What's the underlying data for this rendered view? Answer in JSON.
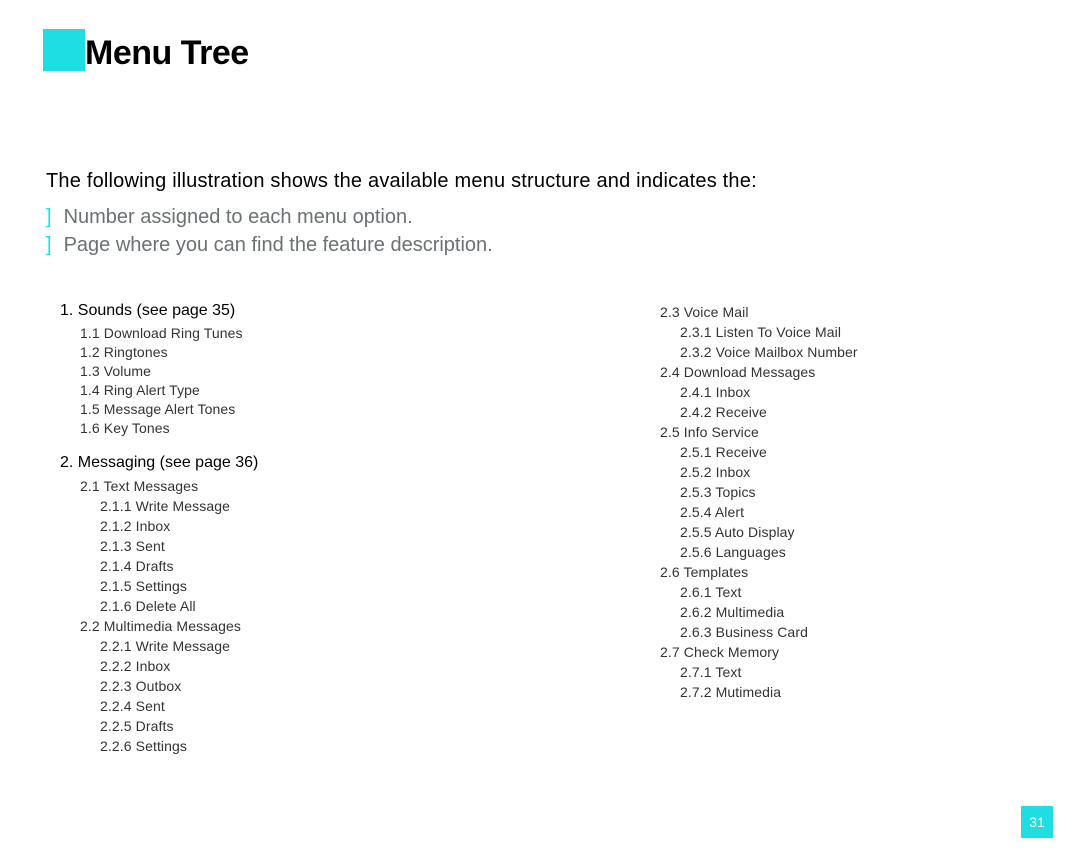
{
  "title": "Menu Tree",
  "intro": "The following illustration shows the available menu structure and indicates the:",
  "bullets": [
    "Number assigned to each menu option.",
    "Page where you can find the feature description."
  ],
  "leftColumn": {
    "sections": [
      {
        "heading": "1.  Sounds (see page 35)",
        "items": [
          {
            "indent": 1,
            "text": "1.1 Download Ring Tunes"
          },
          {
            "indent": 1,
            "text": "1.2 Ringtones"
          },
          {
            "indent": 1,
            "text": "1.3 Volume"
          },
          {
            "indent": 1,
            "text": "1.4 Ring Alert Type"
          },
          {
            "indent": 1,
            "text": "1.5 Message Alert Tones"
          },
          {
            "indent": 1,
            "text": "1.6 Key Tones"
          }
        ]
      },
      {
        "heading": "2.  Messaging (see page 36)",
        "items": [
          {
            "indent": 1,
            "text": "2.1 Text Messages"
          },
          {
            "indent": 2,
            "text": "2.1.1 Write Message"
          },
          {
            "indent": 2,
            "text": "2.1.2 Inbox"
          },
          {
            "indent": 2,
            "text": "2.1.3 Sent"
          },
          {
            "indent": 2,
            "text": "2.1.4 Drafts"
          },
          {
            "indent": 2,
            "text": "2.1.5 Settings"
          },
          {
            "indent": 2,
            "text": "2.1.6 Delete All"
          },
          {
            "indent": 1,
            "text": "2.2 Multimedia Messages"
          },
          {
            "indent": 2,
            "text": "2.2.1 Write Message"
          },
          {
            "indent": 2,
            "text": "2.2.2 Inbox"
          },
          {
            "indent": 2,
            "text": "2.2.3 Outbox"
          },
          {
            "indent": 2,
            "text": "2.2.4 Sent"
          },
          {
            "indent": 2,
            "text": "2.2.5 Drafts"
          },
          {
            "indent": 2,
            "text": "2.2.6 Settings"
          }
        ]
      }
    ]
  },
  "rightColumn": {
    "items": [
      {
        "indent": 1,
        "text": "2.3 Voice Mail"
      },
      {
        "indent": 2,
        "text": "2.3.1 Listen To Voice Mail"
      },
      {
        "indent": 2,
        "text": "2.3.2 Voice Mailbox Number"
      },
      {
        "indent": 1,
        "text": "2.4 Download Messages"
      },
      {
        "indent": 2,
        "text": "2.4.1 Inbox"
      },
      {
        "indent": 2,
        "text": "2.4.2 Receive"
      },
      {
        "indent": 1,
        "text": "2.5 Info Service"
      },
      {
        "indent": 2,
        "text": "2.5.1 Receive"
      },
      {
        "indent": 2,
        "text": "2.5.2 Inbox"
      },
      {
        "indent": 2,
        "text": "2.5.3 Topics"
      },
      {
        "indent": 2,
        "text": "2.5.4 Alert"
      },
      {
        "indent": 2,
        "text": "2.5.5 Auto Display"
      },
      {
        "indent": 2,
        "text": "2.5.6 Languages"
      },
      {
        "indent": 1,
        "text": "2.6 Templates"
      },
      {
        "indent": 2,
        "text": "2.6.1 Text"
      },
      {
        "indent": 2,
        "text": "2.6.2 Multimedia"
      },
      {
        "indent": 2,
        "text": "2.6.3 Business Card"
      },
      {
        "indent": 1,
        "text": "2.7 Check Memory"
      },
      {
        "indent": 2,
        "text": "2.7.1 Text"
      },
      {
        "indent": 2,
        "text": "2.7.2 Mutimedia"
      }
    ]
  },
  "pageNumber": "31"
}
